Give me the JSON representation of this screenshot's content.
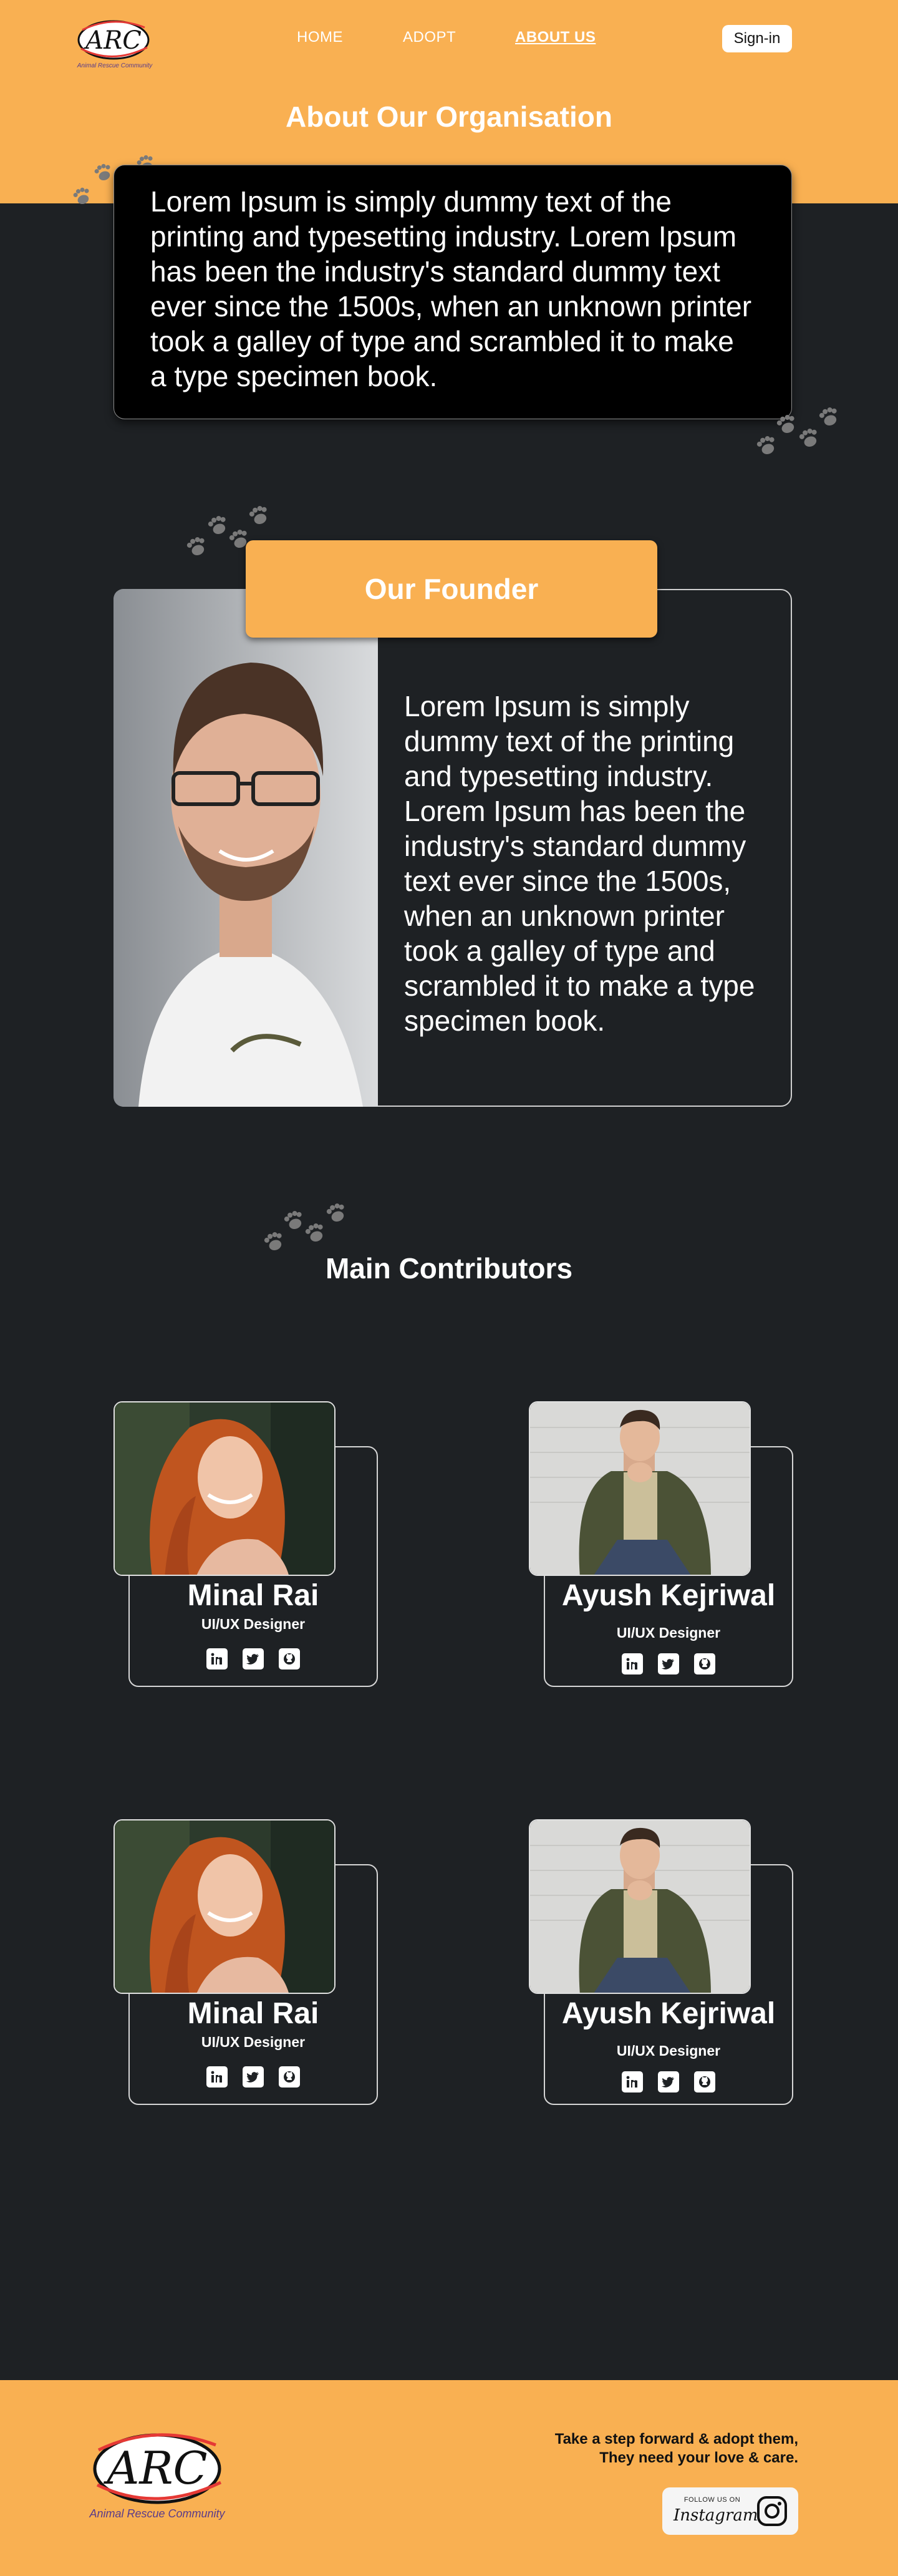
{
  "brand": {
    "logo_text": "ARC",
    "logo_sub": "Animal Rescue Community"
  },
  "nav": {
    "home": "HOME",
    "adopt": "ADOPT",
    "about": "ABOUT US",
    "signin": "Sign-in"
  },
  "about": {
    "title": "About Our Organisation",
    "body": "Lorem Ipsum is simply dummy text of the printing and typesetting industry. Lorem Ipsum has been the industry's standard dummy text ever since the 1500s, when an unknown printer took a galley of type and scrambled it to make a type specimen book."
  },
  "founder": {
    "title": "Our Founder",
    "body": "Lorem Ipsum is simply dummy text of the printing and typesetting industry. Lorem Ipsum has been the industry's standard dummy text ever since the 1500s, when an unknown printer took a galley of type and scrambled it to make a type specimen book."
  },
  "contributors": {
    "title": "Main Contributors",
    "people": [
      {
        "name": "Minal Rai",
        "role": "UI/UX Designer"
      },
      {
        "name": "Ayush Kejriwal",
        "role": "UI/UX Designer"
      },
      {
        "name": "Minal Rai",
        "role": "UI/UX Designer"
      },
      {
        "name": "Ayush Kejriwal",
        "role": "UI/UX Designer"
      }
    ],
    "socials": [
      "linkedin-icon",
      "twitter-icon",
      "github-icon"
    ]
  },
  "footer": {
    "tagline_1": "Take a step forward & adopt them,",
    "tagline_2": "They need your love & care.",
    "insta_small": "FOLLOW US ON",
    "insta_word": "Instagram"
  },
  "colors": {
    "accent": "#f9b052",
    "background": "#1e2124",
    "panel": "#000000"
  }
}
